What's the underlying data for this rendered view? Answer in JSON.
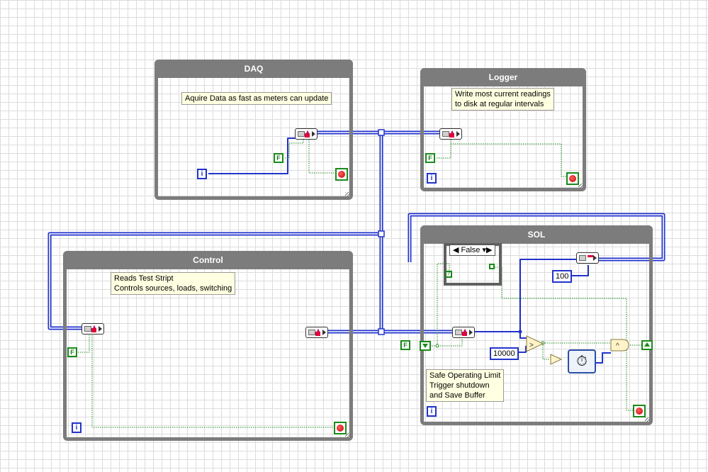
{
  "loops": {
    "daq": {
      "title": "DAQ",
      "note": "Aquire Data as fast as meters can update"
    },
    "logger": {
      "title": "Logger",
      "note_line1": "Write most current readings",
      "note_line2": "to disk at regular intervals"
    },
    "control": {
      "title": "Control",
      "note_line1": "Reads Test Stript",
      "note_line2": "Controls sources, loads, switching"
    },
    "sol": {
      "title": "SOL",
      "note_line1": "Safe Operating Limit",
      "note_line2": "Trigger shutdown",
      "note_line3": "and Save Buffer"
    }
  },
  "constants": {
    "false_short": "F",
    "iteration": "i",
    "case_selector": "False",
    "limit": "10000",
    "wait_ms": "100",
    "greater_symbol": ">",
    "and_symbol": "^"
  },
  "icons": {
    "notifier": "notifier-icon",
    "stop": "stop-terminal-icon",
    "timer": "stopwatch-icon",
    "compare": "greater-than-icon",
    "and": "and-gate-icon"
  },
  "colors": {
    "loop_border": "#7c7c7c",
    "wire_blue": "#2233cc",
    "wire_green": "#1a8a1a",
    "note_bg": "#ffffe1"
  }
}
